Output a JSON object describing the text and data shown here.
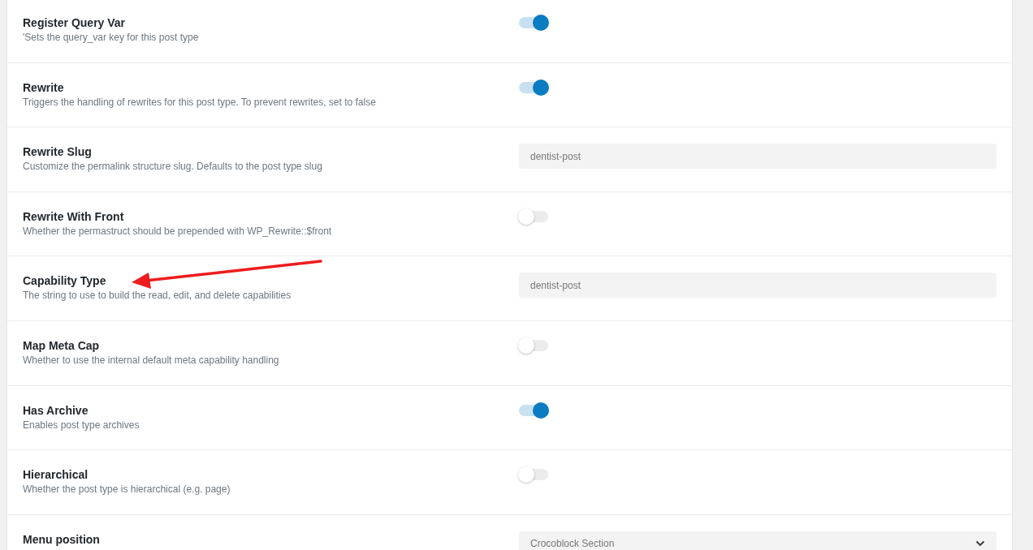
{
  "settings": [
    {
      "kind": "toggle",
      "title": "Register Query Var",
      "description": "'Sets the query_var key for this post type",
      "on": true
    },
    {
      "kind": "toggle",
      "title": "Rewrite",
      "description": "Triggers the handling of rewrites for this post type. To prevent rewrites, set to false",
      "on": true
    },
    {
      "kind": "input",
      "title": "Rewrite Slug",
      "description": "Customize the permalink structure slug. Defaults to the post type slug",
      "value": "dentist-post"
    },
    {
      "kind": "toggle",
      "title": "Rewrite With Front",
      "description": "Whether the permastruct should be prepended with WP_Rewrite::$front",
      "on": false
    },
    {
      "kind": "input",
      "title": "Capability Type",
      "description": "The string to use to build the read, edit, and delete capabilities",
      "value": "dentist-post"
    },
    {
      "kind": "toggle",
      "title": "Map Meta Cap",
      "description": "Whether to use the internal default meta capability handling",
      "on": false
    },
    {
      "kind": "toggle",
      "title": "Has Archive",
      "description": "Enables post type archives",
      "on": true
    },
    {
      "kind": "toggle",
      "title": "Hierarchical",
      "description": "Whether the post type is hierarchical (e.g. page)",
      "on": false
    },
    {
      "kind": "select",
      "title": "Menu position",
      "value": "Crocoblock Section"
    }
  ]
}
